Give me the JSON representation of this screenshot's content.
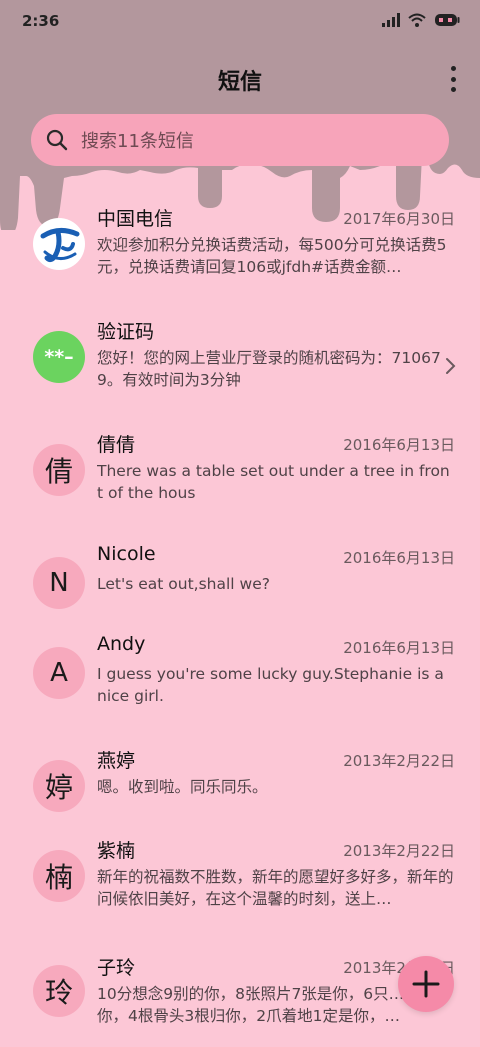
{
  "status_bar": {
    "time": "2:36",
    "icons": [
      "signal-icon",
      "wifi-icon",
      "battery-icon"
    ]
  },
  "header": {
    "title": "短信",
    "more_icon": "more-vertical-icon"
  },
  "search": {
    "placeholder": "搜索11条短信",
    "icon": "search-icon"
  },
  "conversations": [
    {
      "name": "中国电信",
      "date": "2017年6月30日",
      "preview": "欢迎参加积分兑换话费活动，每500分可兑换话费5元，兑换话费请回复106或jfdh#话费金额…",
      "avatar_type": "logo",
      "avatar_icon": "china-telecom-logo-icon"
    },
    {
      "name": "验证码",
      "date": "",
      "preview": "您好！您的网上营业厅登录的随机密码为：710679。有效时间为3分钟",
      "avatar_type": "code",
      "avatar_text": "**–",
      "avatar_color": "#6bd35f"
    },
    {
      "name": "倩倩",
      "date": "2016年6月13日",
      "preview": "There was a table set out under a tree in front of the hous",
      "avatar_text": "倩"
    },
    {
      "name": "Nicole",
      "date": "2016年6月13日",
      "preview": "Let's eat out,shall we?",
      "avatar_text": "N"
    },
    {
      "name": "Andy",
      "date": "2016年6月13日",
      "preview": "I guess you're some lucky guy.Stephanie is a nice girl.",
      "avatar_text": "A"
    },
    {
      "name": "燕婷",
      "date": "2013年2月22日",
      "preview": "嗯。收到啦。同乐同乐。",
      "avatar_text": "婷"
    },
    {
      "name": "紫楠",
      "date": "2013年2月22日",
      "preview": "新年的祝福数不胜数，新年的愿望好多好多，新年的问候依旧美好，在这个温馨的时刻，送上…",
      "avatar_text": "楠"
    },
    {
      "name": "子玲",
      "date": "2013年2月22日",
      "preview": "10分想念9别的你，8张照片7张是你，6只…只像你，4根骨头3根归你，2爪着地1定是你，…",
      "avatar_text": "玲"
    }
  ],
  "fab": {
    "icon": "plus-icon"
  },
  "colors": {
    "background": "#fcc7d6",
    "drip": "#b3979d",
    "search_bg": "#f7a4ba",
    "avatar_bg": "#f7a9bd",
    "fab_bg": "#f58aa8",
    "code_avatar": "#6bd35f"
  }
}
